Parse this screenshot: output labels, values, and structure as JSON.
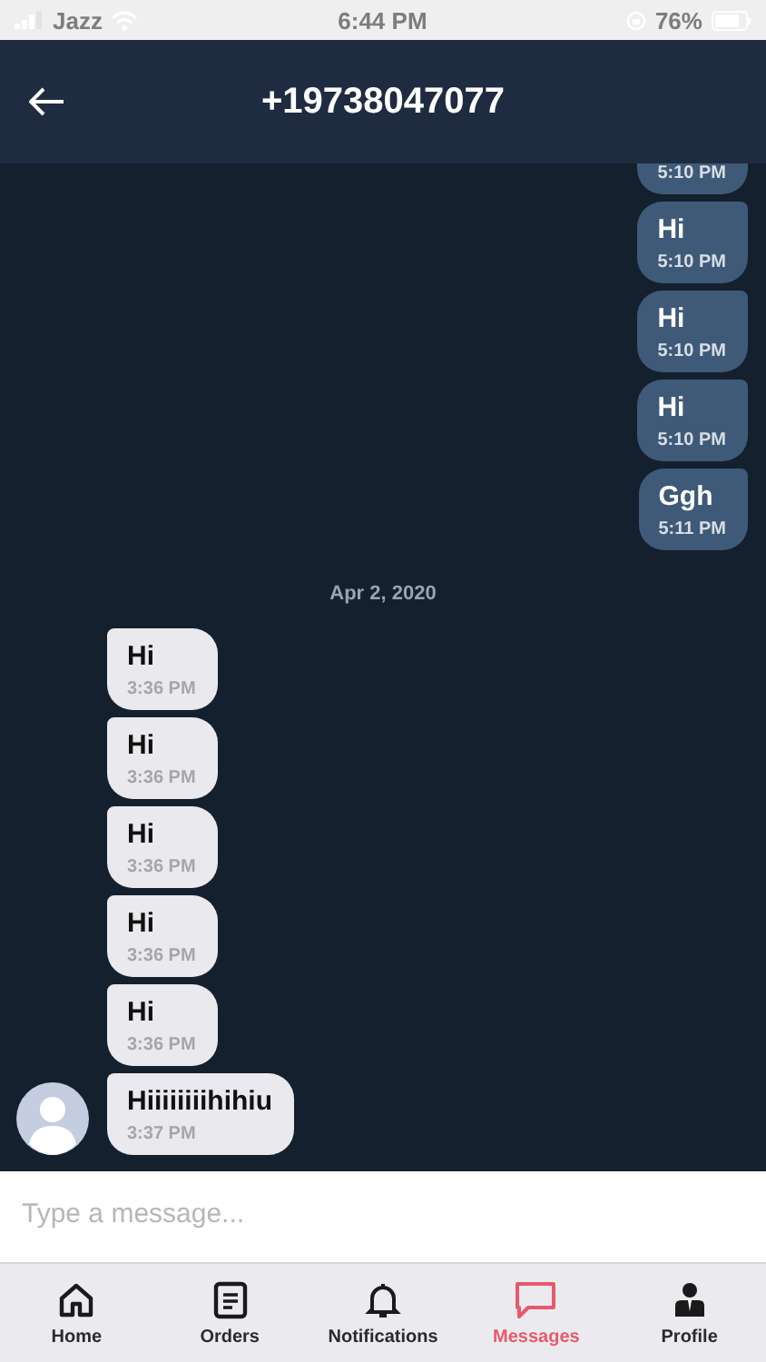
{
  "status_bar": {
    "carrier": "Jazz",
    "time": "6:44 PM",
    "battery": "76%"
  },
  "header": {
    "title": "+19738047077"
  },
  "messages": [
    {
      "kind": "outgoing",
      "time": "5:10 PM"
    },
    {
      "kind": "outgoing",
      "text": "Hi",
      "time": "5:10 PM"
    },
    {
      "kind": "outgoing",
      "text": "Hi",
      "time": "5:10 PM"
    },
    {
      "kind": "outgoing",
      "text": "Hi",
      "time": "5:10 PM"
    },
    {
      "kind": "outgoing",
      "text": "Ggh",
      "time": "5:11 PM"
    },
    {
      "kind": "date",
      "text": "Apr 2, 2020"
    },
    {
      "kind": "incoming",
      "text": "Hi",
      "time": "3:36 PM",
      "avatar": false
    },
    {
      "kind": "incoming",
      "text": "Hi",
      "time": "3:36 PM",
      "avatar": false
    },
    {
      "kind": "incoming",
      "text": "Hi",
      "time": "3:36 PM",
      "avatar": false
    },
    {
      "kind": "incoming",
      "text": "Hi",
      "time": "3:36 PM",
      "avatar": false
    },
    {
      "kind": "incoming",
      "text": "Hi",
      "time": "3:36 PM",
      "avatar": false
    },
    {
      "kind": "incoming",
      "text": "Hiiiiiiiihihiu",
      "time": "3:37 PM",
      "avatar": true
    }
  ],
  "composer": {
    "placeholder": "Type a message..."
  },
  "tabs": [
    {
      "label": "Home",
      "selected": false
    },
    {
      "label": "Orders",
      "selected": false
    },
    {
      "label": "Notifications",
      "selected": false
    },
    {
      "label": "Messages",
      "selected": true
    },
    {
      "label": "Profile",
      "selected": false
    }
  ]
}
